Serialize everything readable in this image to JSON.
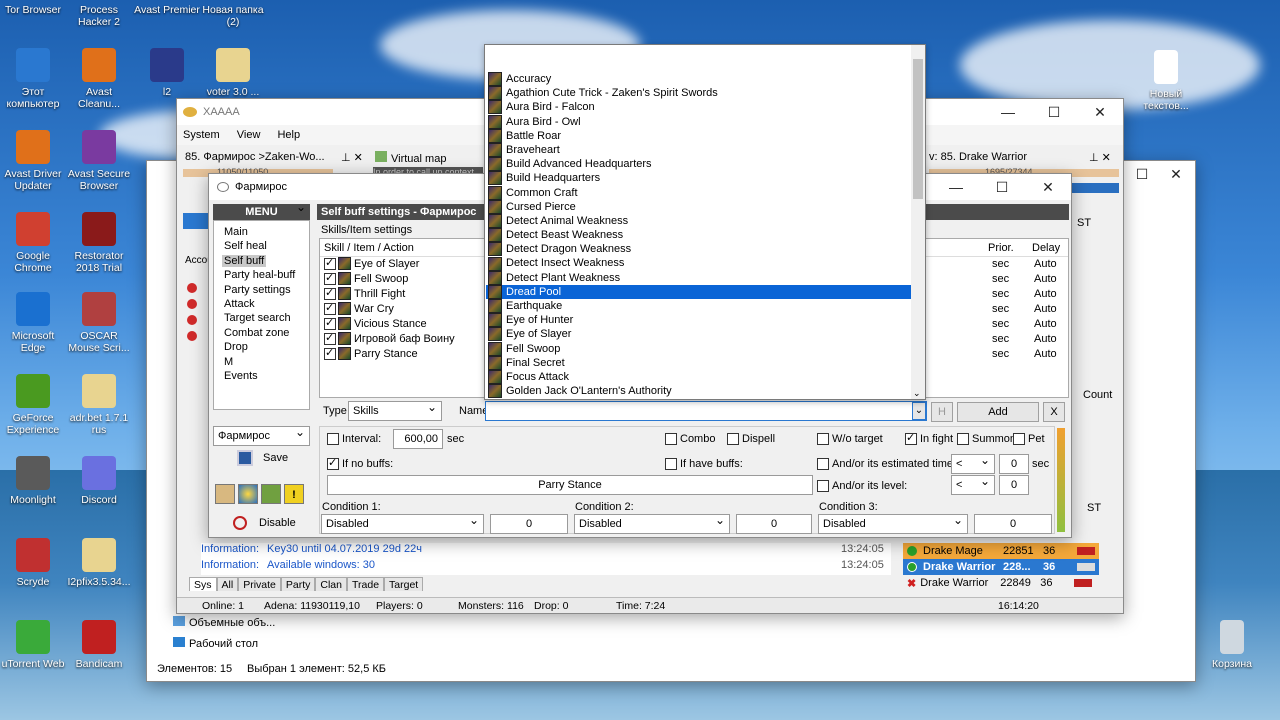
{
  "desktop": {
    "icons_left": [
      {
        "label": "Tor Browser",
        "color": "#7a3aa0"
      },
      {
        "label": "Этот компьютер",
        "color": "#2a78d0"
      },
      {
        "label": "Avast Driver Updater",
        "color": "#e0701a"
      },
      {
        "label": "Google Chrome",
        "color": "#d04030"
      },
      {
        "label": "Microsoft Edge",
        "color": "#1a70d0"
      },
      {
        "label": "GeForce Experience",
        "color": "#4a9a20"
      },
      {
        "label": "Moonlight",
        "color": "#5a5a5a"
      },
      {
        "label": "Scryde",
        "color": "#c03030"
      },
      {
        "label": "uTorrent Web",
        "color": "#3aaa3a"
      }
    ],
    "icons_col2": [
      {
        "label": "Process Hacker 2",
        "color": "#3a6ad0"
      },
      {
        "label": "Avast Cleanu...",
        "color": "#e0701a"
      },
      {
        "label": "Avast Secure Browser",
        "color": "#7a3aa0"
      },
      {
        "label": "Restorator 2018 Trial",
        "color": "#8a1a1a"
      },
      {
        "label": "OSCAR Mouse Scri...",
        "color": "#b04040"
      },
      {
        "label": "adr.bet 1.7.1 rus",
        "color": "#e8d490"
      },
      {
        "label": "Discord",
        "color": "#6a70e0"
      },
      {
        "label": "I2pfix3.5.34...",
        "color": "#e8d490"
      },
      {
        "label": "Bandicam",
        "color": "#c02020"
      }
    ],
    "icons_top": [
      {
        "label": "Avast Premier",
        "color": "#e0701a"
      },
      {
        "label": "Новая папка (2)",
        "color": "#e8c35a"
      },
      {
        "label": "l2",
        "color": "#2a3a8a"
      },
      {
        "label": "voter 3.0 ...",
        "color": "#e8d490"
      }
    ],
    "icons_right": [
      {
        "label": "Новый текстов...",
        "color": "#ffffff"
      },
      {
        "label": "Корзина",
        "color": "#cfd8e0"
      }
    ]
  },
  "main_window": {
    "title": "XAAAA",
    "menu": [
      "System",
      "View",
      "Help"
    ],
    "tab_left": "85. Фармирос >Zaken-Wo...",
    "tab_mid": "Virtual map",
    "tab_right": "v: 85. Drake Warrior",
    "hp_left": "11050/11050",
    "hp_right": "1695/27344",
    "tooltip_text": "In order to call up context",
    "right_panel_headers": [
      "ST"
    ],
    "right_count_label": "Count",
    "log_lines": [
      {
        "label": "Information:",
        "text": "Key30  until 04.07.2019  29d 22ч",
        "time": "13:24:05"
      },
      {
        "label": "Information:",
        "text": "Available windows: 30",
        "time": "13:24:05"
      }
    ],
    "log_tabs": [
      "Sys",
      "All",
      "Private",
      "Party",
      "Clan",
      "Trade",
      "Target"
    ],
    "party": [
      {
        "name": "Drake Mage",
        "hp": "22851",
        "lvl": "36",
        "selected": false
      },
      {
        "name": "Drake Warrior",
        "hp": "228...",
        "lvl": "36",
        "selected": true
      },
      {
        "name": "Drake Warrior",
        "hp": "22849",
        "lvl": "36",
        "selected": false
      }
    ],
    "status": {
      "online": "Online: 1",
      "adena": "Adena: 11930119,10",
      "players": "Players: 0",
      "monsters": "Monsters: 116",
      "drop": "Drop: 0",
      "time": "Time: 7:24",
      "clock": "16:14:20"
    }
  },
  "explorer": {
    "items": [
      "Объемные объ...",
      "Рабочий стол"
    ],
    "status_count": "Элементов: 15",
    "status_sel": "Выбран 1 элемент: 52,5 КБ"
  },
  "dialog": {
    "title": "Фармирос",
    "menu_header": "MENU",
    "settings_header": "Self buff settings - Фармирос",
    "menu_items": [
      "Main",
      "Self heal",
      "Self buff",
      "Party heal-buff",
      "Party settings",
      "Attack",
      "Target search",
      "Combat zone",
      "Drop",
      "M",
      "Events"
    ],
    "selected_menu": "Self buff",
    "char_select": "Фармирос",
    "save_label": "Save",
    "disable_label": "Disable",
    "group_label": "Skills/Item settings",
    "col_skill": "Skill / Item / Action",
    "col_prior": "Prior.",
    "col_delay": "Delay",
    "skills": [
      {
        "name": "Eye of Slayer",
        "prior": "sec",
        "delay": "Auto"
      },
      {
        "name": "Fell Swoop",
        "prior": "sec",
        "delay": "Auto"
      },
      {
        "name": "Thrill Fight",
        "prior": "sec",
        "delay": "Auto"
      },
      {
        "name": "War Cry",
        "prior": "sec",
        "delay": "Auto"
      },
      {
        "name": "Vicious Stance",
        "prior": "sec",
        "delay": "Auto"
      },
      {
        "name": "Игровой баф Воину",
        "prior": "sec",
        "delay": "Auto"
      },
      {
        "name": "Parry Stance",
        "prior": "sec",
        "delay": "Auto"
      }
    ],
    "type_label": "Type",
    "type_value": "Skills",
    "name_label": "Name",
    "h_label": "H",
    "add_label": "Add",
    "x_label": "X",
    "interval_label": "Interval:",
    "interval_value": "600,00",
    "sec_label": "sec",
    "combo_label": "Combo",
    "dispell_label": "Dispell",
    "wo_target_label": "W/o target",
    "in_fight_label": "In fight",
    "summon_label": "Summon",
    "pet_label": "Pet",
    "if_no_buffs_label": "If no buffs:",
    "if_have_buffs_label": "If have buffs:",
    "estimated_time_label": "And/or its estimated time:",
    "level_label": "And/or its level:",
    "lt": "<",
    "zero": "0",
    "sec2": "sec",
    "no_buff_value": "Parry Stance",
    "cond1_label": "Condition 1:",
    "cond2_label": "Condition 2:",
    "cond3_label": "Condition 3:",
    "cond_value": "Disabled",
    "cond_num": "0"
  },
  "dropdown": {
    "items": [
      "Accuracy",
      "Agathion Cute Trick - Zaken's Spirit Swords",
      "Aura Bird - Falcon",
      "Aura Bird - Owl",
      "Battle Roar",
      "Braveheart",
      "Build Advanced Headquarters",
      "Build Headquarters",
      "Common Craft",
      "Cursed Pierce",
      "Detect Animal Weakness",
      "Detect Beast Weakness",
      "Detect Dragon Weakness",
      "Detect Insect Weakness",
      "Detect Plant Weakness",
      "Dread Pool",
      "Earthquake",
      "Eye of Hunter",
      "Eye of Slayer",
      "Fell Swoop",
      "Final Secret",
      "Focus Attack",
      "Golden Jack O'Lantern's Authority"
    ],
    "selected": "Dread Pool"
  }
}
